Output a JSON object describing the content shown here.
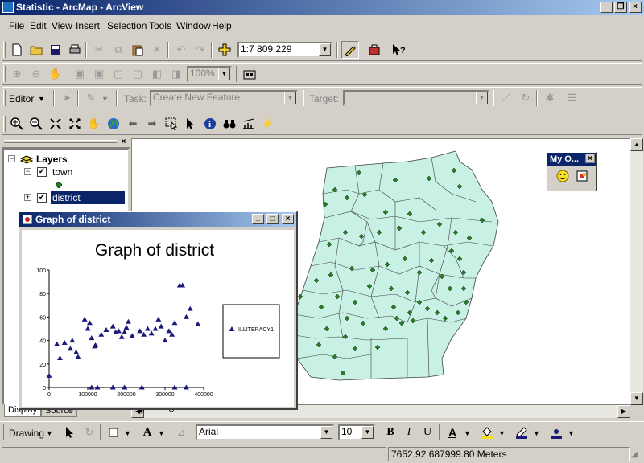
{
  "window": {
    "title": "Statistic - ArcMap - ArcView"
  },
  "menu": [
    "File",
    "Edit",
    "View",
    "Insert",
    "Selection",
    "Tools",
    "Window",
    "Help"
  ],
  "standard_toolbar": {
    "scale_value": "1:7 809 229"
  },
  "layout_toolbar": {
    "zoom_value": "100%"
  },
  "editor_toolbar": {
    "editor_label": "Editor",
    "task_label": "Task:",
    "task_value": "Create New Feature",
    "target_label": "Target:"
  },
  "toc": {
    "layers_label": "Layers",
    "layer_town": "town",
    "layer_district": "district",
    "tab_display": "Display",
    "tab_source": "Source"
  },
  "myo": {
    "title": "My O..."
  },
  "graph_window": {
    "title": "Graph of district",
    "chart_title": "Graph of district",
    "legend_label": "ILLITERACY1"
  },
  "chart_data": {
    "type": "scatter",
    "title": "Graph of district",
    "xlabel": "",
    "ylabel": "",
    "xlim": [
      0,
      400000
    ],
    "ylim": [
      0,
      100
    ],
    "xticks": [
      "0",
      "100000",
      "200000",
      "300000",
      "400000"
    ],
    "yticks": [
      "0",
      "20",
      "40",
      "60",
      "80",
      "100"
    ],
    "legend": "right",
    "series": [
      {
        "name": "ILLITERACY1",
        "color": "#1a1a7a",
        "points": [
          [
            0,
            10
          ],
          [
            20000,
            37
          ],
          [
            28000,
            25
          ],
          [
            55000,
            33
          ],
          [
            60000,
            40
          ],
          [
            70000,
            30
          ],
          [
            75000,
            26
          ],
          [
            92000,
            58
          ],
          [
            100000,
            50
          ],
          [
            105000,
            55
          ],
          [
            110000,
            42
          ],
          [
            118000,
            35
          ],
          [
            120000,
            36
          ],
          [
            135000,
            45
          ],
          [
            165000,
            52
          ],
          [
            172000,
            47
          ],
          [
            180000,
            48
          ],
          [
            188000,
            43
          ],
          [
            195000,
            47
          ],
          [
            200000,
            51
          ],
          [
            205000,
            56
          ],
          [
            215000,
            44
          ],
          [
            235000,
            48
          ],
          [
            245000,
            45
          ],
          [
            255000,
            50
          ],
          [
            265000,
            46
          ],
          [
            275000,
            50
          ],
          [
            283000,
            58
          ],
          [
            290000,
            52
          ],
          [
            300000,
            40
          ],
          [
            318000,
            45
          ],
          [
            325000,
            55
          ],
          [
            338000,
            87
          ],
          [
            345000,
            87
          ],
          [
            355000,
            60
          ],
          [
            365000,
            67
          ],
          [
            385000,
            54
          ],
          [
            40000,
            38
          ],
          [
            148000,
            49
          ],
          [
            310000,
            48
          ],
          [
            110000,
            0
          ],
          [
            125000,
            0
          ],
          [
            165000,
            0
          ],
          [
            195000,
            0
          ],
          [
            240000,
            0
          ],
          [
            325000,
            0
          ],
          [
            355000,
            0
          ]
        ]
      }
    ]
  },
  "drawing_toolbar": {
    "drawing_label": "Drawing",
    "font_name": "Arial",
    "font_size": "10",
    "bold": "B",
    "italic": "I",
    "underline": "U",
    "font_color_glyph": "A"
  },
  "statusbar": {
    "coords": "7652.92  687999.80 Meters"
  }
}
